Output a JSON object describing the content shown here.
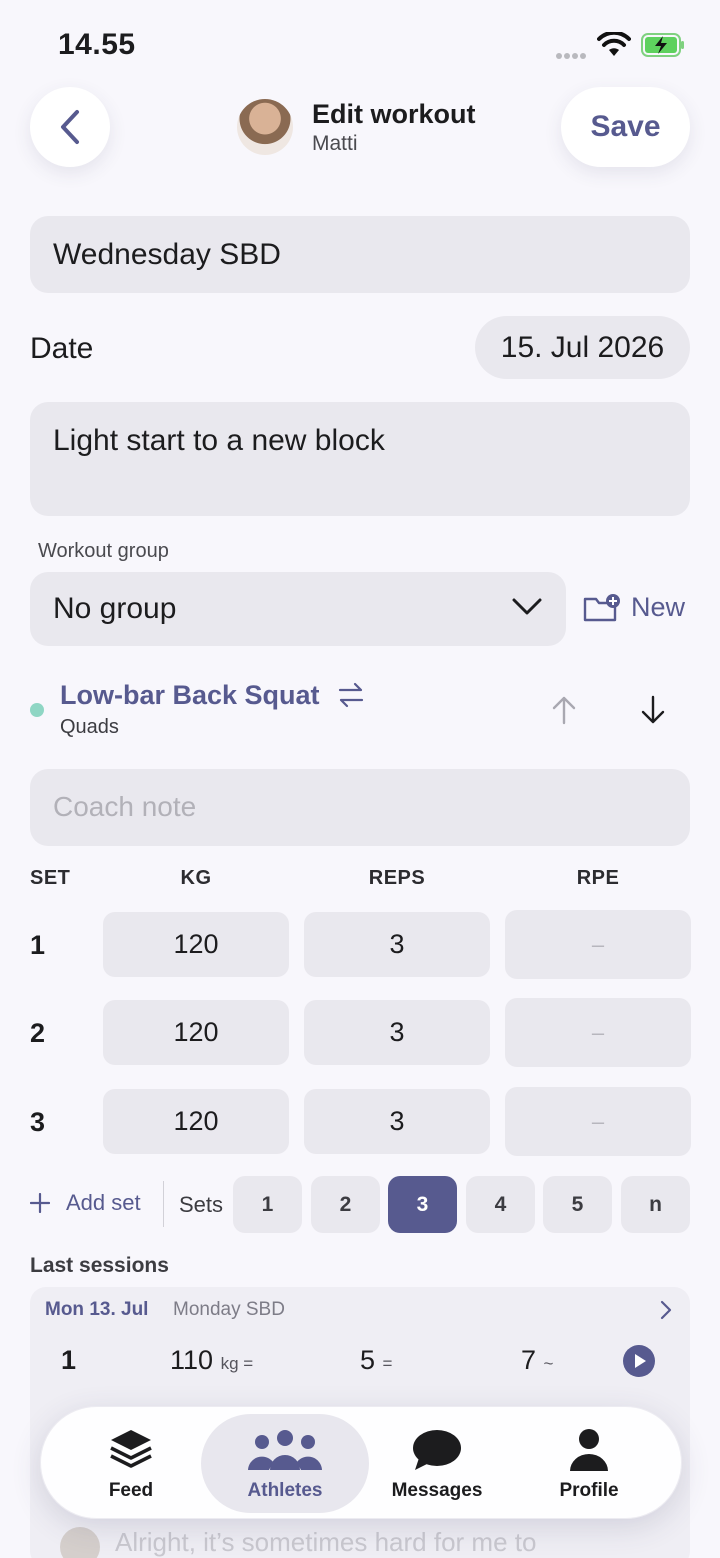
{
  "status_bar": {
    "time": "14.55"
  },
  "header": {
    "title": "Edit workout",
    "subtitle": "Matti",
    "save_label": "Save"
  },
  "form": {
    "workout_name": "Wednesday SBD",
    "date_label": "Date",
    "date_value": "15. Jul 2026",
    "notes": "Light start to a new block",
    "workout_group_label": "Workout group",
    "workout_group_value": "No group",
    "new_group_label": "New"
  },
  "exercise": {
    "name": "Low-bar Back Squat",
    "muscle": "Quads",
    "muscle_color": "#8fd6c4",
    "coach_note_placeholder": "Coach note",
    "columns": [
      "SET",
      "KG",
      "REPS",
      "RPE"
    ],
    "sets": [
      {
        "set": "1",
        "kg": "120",
        "reps": "3",
        "rpe": "–"
      },
      {
        "set": "2",
        "kg": "120",
        "reps": "3",
        "rpe": "–"
      },
      {
        "set": "3",
        "kg": "120",
        "reps": "3",
        "rpe": "–"
      }
    ],
    "add_set_label": "Add set",
    "sets_label": "Sets",
    "set_count_options": [
      "1",
      "2",
      "3",
      "4",
      "5",
      "n"
    ],
    "selected_set_count": "3"
  },
  "last_sessions": {
    "title": "Last sessions",
    "session": {
      "date": "Mon 13. Jul",
      "name": "Monday SBD",
      "row": {
        "set": "1",
        "kg": "110",
        "kg_unit": "kg =",
        "reps": "5",
        "reps_suffix": "=",
        "rpe": "7",
        "rpe_suffix": "~"
      }
    },
    "comments": [
      {
        "text": "Alright, it’s sometimes hard for me to"
      }
    ]
  },
  "tab_bar": {
    "tabs": [
      {
        "label": "Feed",
        "icon": "layers-icon"
      },
      {
        "label": "Athletes",
        "icon": "group-icon"
      },
      {
        "label": "Messages",
        "icon": "chat-bubble-icon"
      },
      {
        "label": "Profile",
        "icon": "person-icon"
      }
    ],
    "active": "Athletes"
  },
  "colors": {
    "accent": "#575a8f",
    "field_bg": "#e9e8ee",
    "background": "#f8f7fc"
  }
}
